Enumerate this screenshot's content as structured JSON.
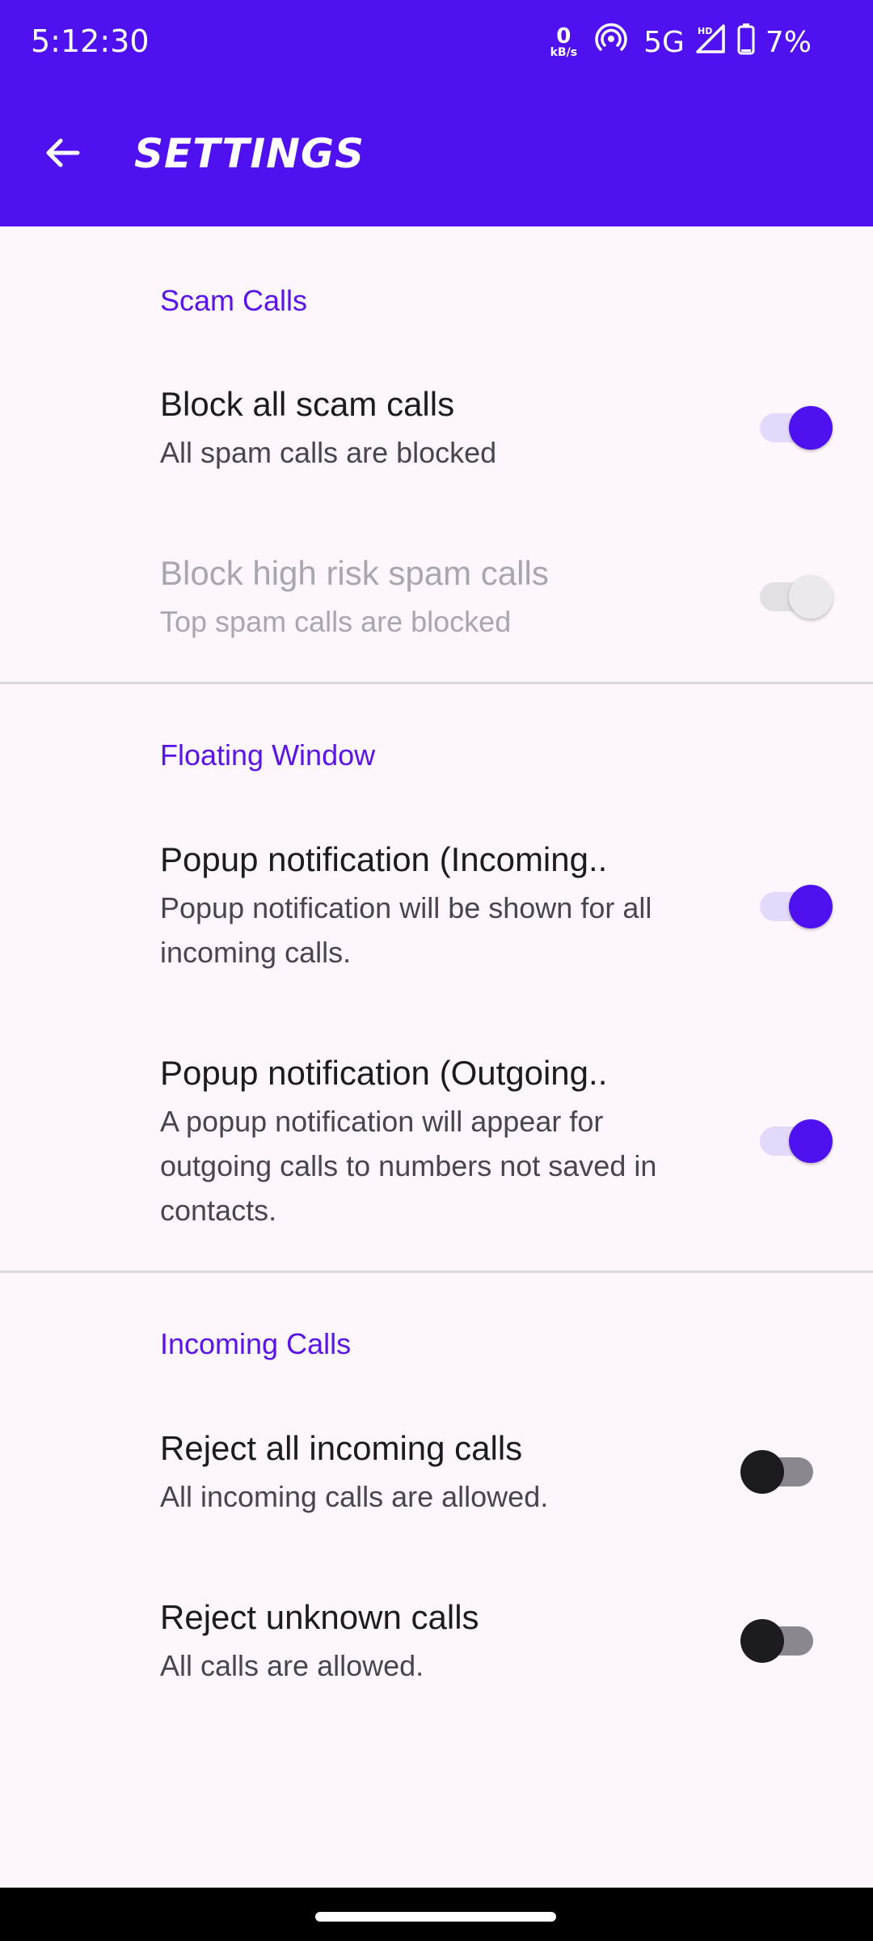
{
  "status_bar": {
    "time": "5:12:30",
    "data_speed_value": "0",
    "data_speed_unit": "kB/s",
    "network": "5G",
    "battery": "7%",
    "icons": [
      "hotspot-icon",
      "hd-signal-icon",
      "battery-icon"
    ]
  },
  "app_bar": {
    "title": "SETTINGS",
    "back_icon": "arrow-back-icon",
    "color": "#5011f0"
  },
  "sections": [
    {
      "header": "Scam Calls",
      "items": [
        {
          "title": "Block all scam calls",
          "subtitle": "All spam calls are blocked",
          "state": "on"
        },
        {
          "title": "Block high risk spam calls",
          "subtitle": "Top spam calls are blocked",
          "state": "on-disabled"
        }
      ]
    },
    {
      "header": "Floating Window",
      "items": [
        {
          "title": "Popup notification (Incoming..",
          "subtitle": "Popup notification will be shown for all incoming calls.",
          "state": "on"
        },
        {
          "title": "Popup notification (Outgoing..",
          "subtitle": "A popup notification will appear for outgoing calls to numbers not saved in contacts.",
          "state": "on"
        }
      ]
    },
    {
      "header": "Incoming Calls",
      "items": [
        {
          "title": "Reject all incoming calls",
          "subtitle": "All incoming calls are allowed.",
          "state": "off"
        },
        {
          "title": "Reject unknown calls",
          "subtitle": "All calls are allowed.",
          "state": "off"
        }
      ]
    }
  ],
  "colors": {
    "accent": "#5011f0",
    "section_header": "#5a14e6",
    "background": "#fdf7fd"
  }
}
